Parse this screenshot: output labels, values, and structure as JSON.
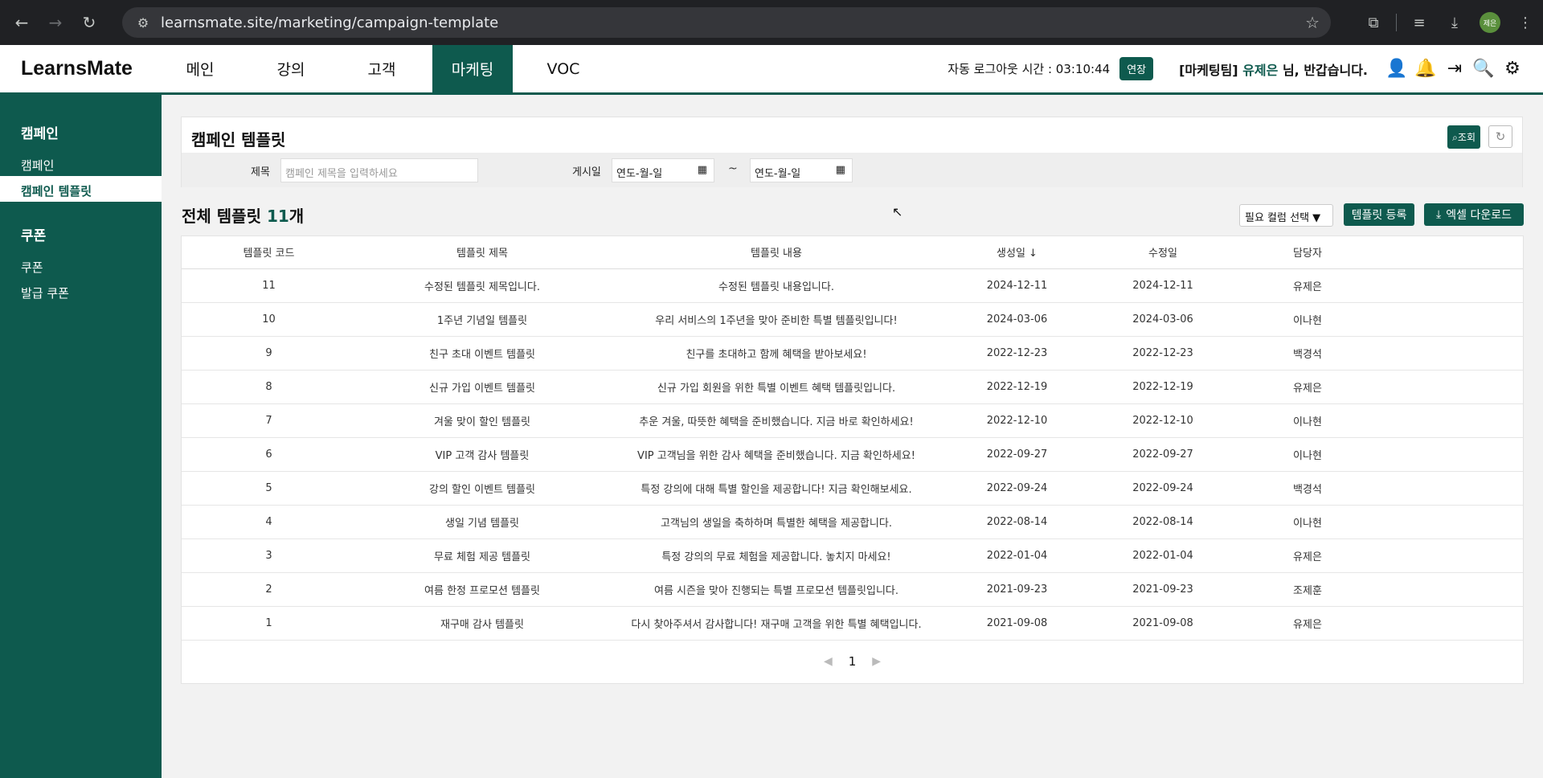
{
  "browser": {
    "url": "learnsmate.site/marketing/campaign-template",
    "profile": "제은"
  },
  "header": {
    "logo": "LearnsMate",
    "nav": [
      {
        "label": "메인"
      },
      {
        "label": "강의"
      },
      {
        "label": "고객"
      },
      {
        "label": "마케팅"
      },
      {
        "label": "VOC"
      }
    ],
    "autologout_label": "자동 로그아웃 시간 : 03:10:44",
    "extend_label": "연장",
    "team": "[마케팅팀]",
    "user": "유제은",
    "greeting": "님, 반갑습니다."
  },
  "sidebar": {
    "groups": [
      {
        "title": "캠페인",
        "items": [
          {
            "label": "캠페인"
          },
          {
            "label": "캠페인 템플릿"
          }
        ]
      },
      {
        "title": "쿠폰",
        "items": [
          {
            "label": "쿠폰"
          },
          {
            "label": "발급 쿠폰"
          }
        ]
      }
    ]
  },
  "search": {
    "title": "캠페인 템플릿",
    "search_btn": "조회",
    "title_label": "제목",
    "title_placeholder": "캠페인 제목을 입력하세요",
    "date_label": "게시일",
    "date_from": "연도-월-일",
    "date_to": "연도-월-일",
    "tilde": "~"
  },
  "list": {
    "title_prefix": "전체 템플릿 ",
    "count": "11",
    "title_suffix": "개",
    "col_select": "필요 컬럼 선택",
    "register_btn": "템플릿 등록",
    "excel_btn": "엑셀 다운로드"
  },
  "table": {
    "headers": [
      "템플릿 코드",
      "템플릿 제목",
      "템플릿 내용",
      "생성일 ↓",
      "수정일",
      "담당자"
    ],
    "rows": [
      [
        "11",
        "수정된 템플릿 제목입니다.",
        "수정된 템플릿 내용입니다.",
        "2024-12-11",
        "2024-12-11",
        "유제은"
      ],
      [
        "10",
        "1주년 기념일 템플릿",
        "우리 서비스의 1주년을 맞아 준비한 특별 템플릿입니다!",
        "2024-03-06",
        "2024-03-06",
        "이나현"
      ],
      [
        "9",
        "친구 초대 이벤트 템플릿",
        "친구를 초대하고 함께 혜택을 받아보세요!",
        "2022-12-23",
        "2022-12-23",
        "백경석"
      ],
      [
        "8",
        "신규 가입 이벤트 템플릿",
        "신규 가입 회원을 위한 특별 이벤트 혜택 템플릿입니다.",
        "2022-12-19",
        "2022-12-19",
        "유제은"
      ],
      [
        "7",
        "겨울 맞이 할인 템플릿",
        "추운 겨울, 따뜻한 혜택을 준비했습니다. 지금 바로 확인하세요!",
        "2022-12-10",
        "2022-12-10",
        "이나현"
      ],
      [
        "6",
        "VIP 고객 감사 템플릿",
        "VIP 고객님을 위한 감사 혜택을 준비했습니다. 지금 확인하세요!",
        "2022-09-27",
        "2022-09-27",
        "이나현"
      ],
      [
        "5",
        "강의 할인 이벤트 템플릿",
        "특정 강의에 대해 특별 할인을 제공합니다! 지금 확인해보세요.",
        "2022-09-24",
        "2022-09-24",
        "백경석"
      ],
      [
        "4",
        "생일 기념 템플릿",
        "고객님의 생일을 축하하며 특별한 혜택을 제공합니다.",
        "2022-08-14",
        "2022-08-14",
        "이나현"
      ],
      [
        "3",
        "무료 체험 제공 템플릿",
        "특정 강의의 무료 체험을 제공합니다. 놓치지 마세요!",
        "2022-01-04",
        "2022-01-04",
        "유제은"
      ],
      [
        "2",
        "여름 한정 프로모션 템플릿",
        "여름 시즌을 맞아 진행되는 특별 프로모션 템플릿입니다.",
        "2021-09-23",
        "2021-09-23",
        "조제훈"
      ],
      [
        "1",
        "재구매 감사 템플릿",
        "다시 찾아주셔서 감사합니다! 재구매 고객을 위한 특별 혜택입니다.",
        "2021-09-08",
        "2021-09-08",
        "유제은"
      ]
    ]
  },
  "pager": {
    "current": "1"
  },
  "colors": {
    "brand": "#0e5a4e"
  }
}
